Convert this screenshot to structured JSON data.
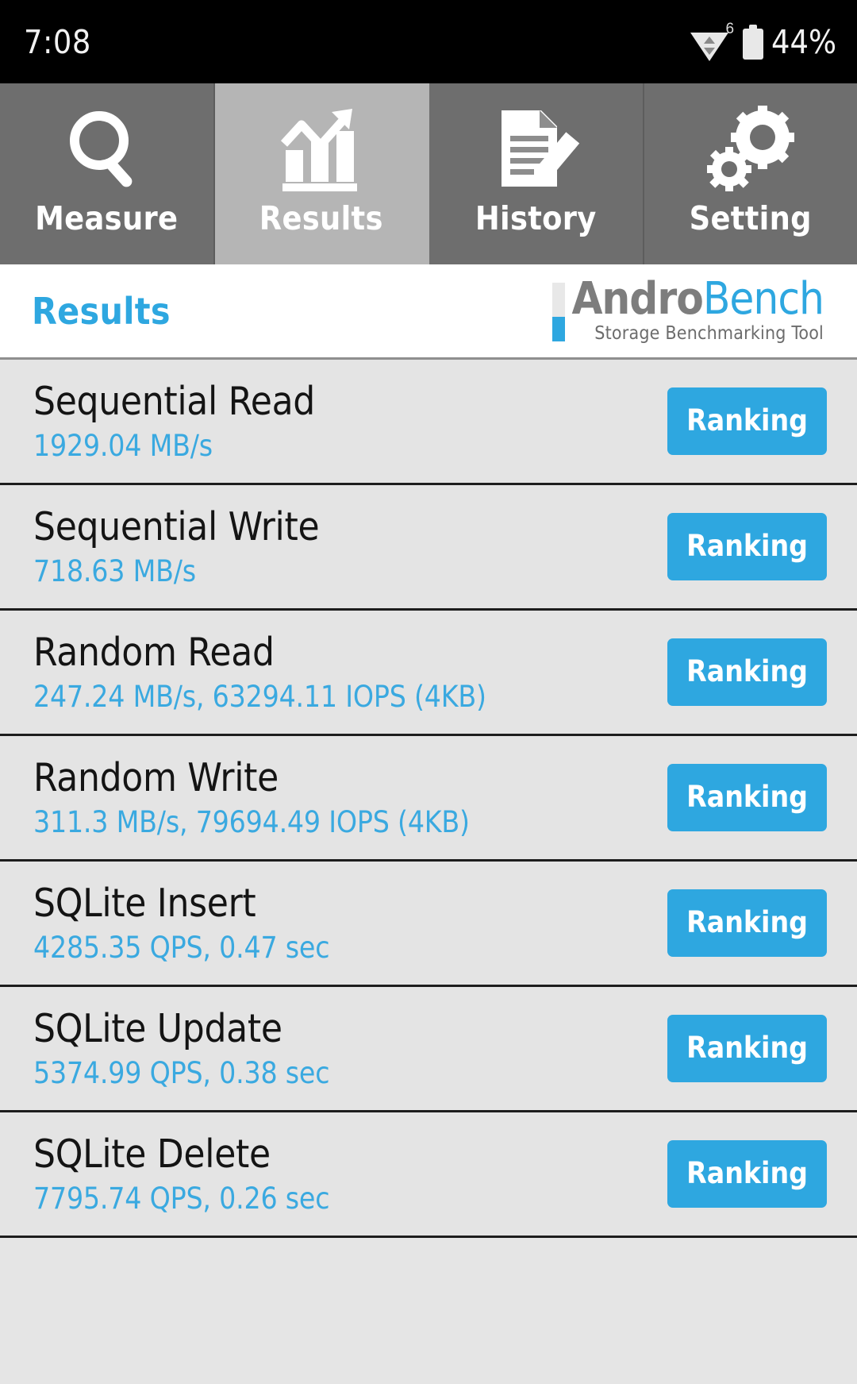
{
  "statusbar": {
    "clock": "7:08",
    "wifi_icon": "wifi-icon",
    "wifi_generation": "6",
    "battery_icon": "battery-icon",
    "battery_text": "44%"
  },
  "tabs": [
    {
      "label": "Measure",
      "icon": "magnifier-icon",
      "active": false
    },
    {
      "label": "Results",
      "icon": "bar-chart-trend-icon",
      "active": true
    },
    {
      "label": "History",
      "icon": "document-pencil-icon",
      "active": false
    },
    {
      "label": "Setting",
      "icon": "gears-icon",
      "active": false
    }
  ],
  "header": {
    "page_title": "Results",
    "logo_primary": "Andro",
    "logo_secondary": "Bench",
    "logo_tagline": "Storage Benchmarking Tool"
  },
  "results": {
    "ranking_label": "Ranking",
    "rows": [
      {
        "name": "Sequential Read",
        "value": "1929.04 MB/s"
      },
      {
        "name": "Sequential Write",
        "value": "718.63 MB/s"
      },
      {
        "name": "Random Read",
        "value": "247.24 MB/s, 63294.11 IOPS (4KB)"
      },
      {
        "name": "Random Write",
        "value": "311.3 MB/s, 79694.49 IOPS (4KB)"
      },
      {
        "name": "SQLite Insert",
        "value": "4285.35 QPS, 0.47 sec"
      },
      {
        "name": "SQLite Update",
        "value": "5374.99 QPS, 0.38 sec"
      },
      {
        "name": "SQLite Delete",
        "value": "7795.74 QPS, 0.26 sec"
      }
    ]
  },
  "colors": {
    "accent": "#2ea7e0",
    "value_text": "#3aa9e0",
    "tab_inactive": "#6e6e6e",
    "tab_active": "#b5b5b5",
    "row_bg": "#e4e4e4",
    "statusbar_bg": "#000000"
  }
}
